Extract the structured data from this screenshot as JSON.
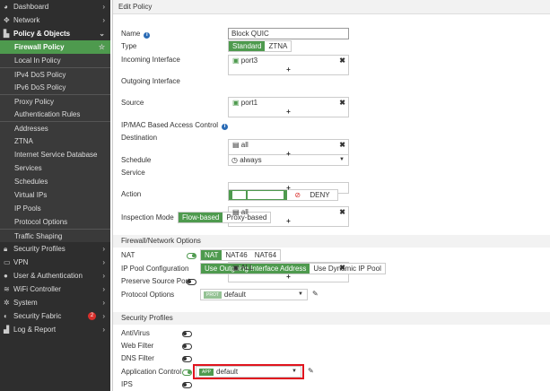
{
  "sidebar": {
    "items": [
      {
        "label": "Dashboard",
        "icon": "dashboard-icon"
      },
      {
        "label": "Network",
        "icon": "network-icon"
      },
      {
        "label": "Policy & Objects",
        "icon": "policy-icon"
      },
      {
        "label": "Firewall Policy"
      },
      {
        "label": "Local In Policy"
      },
      {
        "label": "IPv4 DoS Policy"
      },
      {
        "label": "IPv6 DoS Policy"
      },
      {
        "label": "Proxy Policy"
      },
      {
        "label": "Authentication Rules"
      },
      {
        "label": "Addresses"
      },
      {
        "label": "ZTNA"
      },
      {
        "label": "Internet Service Database"
      },
      {
        "label": "Services"
      },
      {
        "label": "Schedules"
      },
      {
        "label": "Virtual IPs"
      },
      {
        "label": "IP Pools"
      },
      {
        "label": "Protocol Options"
      },
      {
        "label": "Traffic Shaping"
      },
      {
        "label": "Security Profiles",
        "icon": "lock-icon"
      },
      {
        "label": "VPN",
        "icon": "laptop-icon"
      },
      {
        "label": "User & Authentication",
        "icon": "user-icon"
      },
      {
        "label": "WiFi Controller",
        "icon": "wifi-icon"
      },
      {
        "label": "System",
        "icon": "gear-icon"
      },
      {
        "label": "Security Fabric",
        "icon": "fabric-icon",
        "badge": "2"
      },
      {
        "label": "Log & Report",
        "icon": "chart-icon"
      }
    ]
  },
  "header": {
    "title": "Edit Policy"
  },
  "form": {
    "name_label": "Name",
    "name_value": "Block QUIC",
    "type_label": "Type",
    "type_options": [
      "Standard",
      "ZTNA"
    ],
    "incoming_label": "Incoming Interface",
    "incoming_value": "port3",
    "outgoing_label": "Outgoing Interface",
    "outgoing_value": "port1",
    "source_label": "Source",
    "source_value": "all",
    "ipmac_label": "IP/MAC Based Access Control",
    "destination_label": "Destination",
    "destination_value": "all",
    "schedule_label": "Schedule",
    "schedule_value": "always",
    "service_label": "Service",
    "service_value": "ALL",
    "action_label": "Action",
    "accept": "ACCEPT",
    "deny": "DENY",
    "inspection_label": "Inspection Mode",
    "inspection_options": [
      "Flow-based",
      "Proxy-based"
    ],
    "plus": "+",
    "remove": "✖"
  },
  "firewall": {
    "title": "Firewall/Network Options",
    "nat_label": "NAT",
    "nat_options": [
      "NAT",
      "NAT46",
      "NAT64"
    ],
    "ippool_label": "IP Pool Configuration",
    "ippool_options": [
      "Use Outgoing Interface Address",
      "Use Dynamic IP Pool"
    ],
    "preserve_label": "Preserve Source Port",
    "protocol_label": "Protocol Options",
    "protocol_tag": "PROT",
    "protocol_value": "default"
  },
  "security": {
    "title": "Security Profiles",
    "antivirus": "AntiVirus",
    "webfilter": "Web Filter",
    "dnsfilter": "DNS Filter",
    "appcontrol": "Application Control",
    "app_tag": "APP",
    "app_value": "default",
    "ips": "IPS"
  },
  "colors": {
    "accent": "#4e9a4e",
    "highlight": "#e0141e",
    "sidebar": "#2e2e2e"
  }
}
